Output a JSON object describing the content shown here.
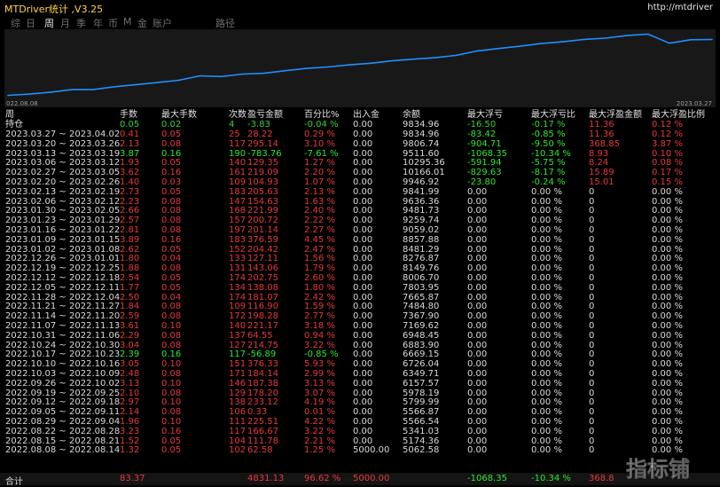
{
  "window": {
    "title": "MTDriver统计  ,V3.25",
    "url": "http://mtdriver"
  },
  "tabs": [
    {
      "label": "综",
      "active": false
    },
    {
      "label": "日",
      "active": false
    },
    {
      "label": "周",
      "active": true
    },
    {
      "label": "月",
      "active": false
    },
    {
      "label": "季",
      "active": false
    },
    {
      "label": "年",
      "active": false
    },
    {
      "label": "币",
      "active": false
    },
    {
      "label": "M",
      "active": false
    },
    {
      "label": "金",
      "active": false
    },
    {
      "label": "账户",
      "active": false
    },
    {
      "label": "路径",
      "active": false
    }
  ],
  "colors": {
    "background": "#000000",
    "chart_line": "#1e90ff",
    "negative": "#e63939",
    "positive": "#2fe62f",
    "accent": "#ffd24a"
  },
  "chart_data": {
    "type": "line",
    "x_start_label": "022.08.08",
    "x_end_label": "2023.03.27",
    "x": [
      "2022.08.08",
      "2022.08.15",
      "2022.08.22",
      "2022.08.29",
      "2022.09.05",
      "2022.09.12",
      "2022.09.19",
      "2022.09.26",
      "2022.10.03",
      "2022.10.10",
      "2022.10.17",
      "2022.10.24",
      "2022.10.31",
      "2022.11.07",
      "2022.11.14",
      "2022.11.21",
      "2022.11.28",
      "2022.12.05",
      "2022.12.12",
      "2022.12.19",
      "2022.12.26",
      "2023.01.02",
      "2023.01.09",
      "2023.01.16",
      "2023.01.23",
      "2023.01.30",
      "2023.02.06",
      "2023.02.13",
      "2023.02.20",
      "2023.02.27",
      "2023.03.06",
      "2023.03.13",
      "2023.03.20",
      "2023.03.27"
    ],
    "values": [
      5062.58,
      5174.36,
      5341.03,
      5566.54,
      5566.87,
      5799.99,
      5978.19,
      6157.57,
      6349.71,
      6726.04,
      6669.15,
      6883.9,
      6948.45,
      7169.62,
      7367.9,
      7484.8,
      7665.87,
      7803.95,
      8006.7,
      8149.76,
      8276.87,
      8481.29,
      8857.88,
      9059.02,
      9259.74,
      9481.73,
      9636.36,
      9841.99,
      9946.92,
      10166.01,
      10295.36,
      9511.6,
      9806.74,
      9834.96
    ],
    "ylim": [
      4800,
      10400
    ],
    "grid": false
  },
  "table": {
    "headers": [
      "周",
      "手数",
      "最大手数",
      "次数",
      "盈亏金额",
      "百分比%",
      "出入金",
      "余额",
      "最大浮亏",
      "最大浮亏比",
      "最大浮盈金额",
      "最大浮盈比例"
    ],
    "hold": {
      "label": "持仓",
      "lots": "0.05",
      "max_lots": "0.02",
      "count": "4",
      "pnl": "-3.83",
      "pct": "-0.04 %",
      "io": "0.00",
      "balance": "9834.96",
      "max_loss": "-16.50",
      "max_loss_pct": "-0.17 %",
      "max_profit": "11.36",
      "max_profit_pct": "0.12 %"
    },
    "rows": [
      {
        "week": "2023.03.27 ~ 2023.04.02",
        "lots": "0.41",
        "max_lots": "0.05",
        "count": "25",
        "pnl": "28.22",
        "pct": "0.29 %",
        "io": "0.00",
        "balance": "9834.96",
        "max_loss": "-83.42",
        "max_loss_pct": "-0.85 %",
        "max_profit": "11.36",
        "max_profit_pct": "0.12 %",
        "sign": "pos"
      },
      {
        "week": "2023.03.20 ~ 2023.03.26",
        "lots": "2.13",
        "max_lots": "0.08",
        "count": "117",
        "pnl": "295.14",
        "pct": "3.10 %",
        "io": "0.00",
        "balance": "9806.74",
        "max_loss": "-904.71",
        "max_loss_pct": "-9.50 %",
        "max_profit": "368.85",
        "max_profit_pct": "3.87 %",
        "sign": "pos"
      },
      {
        "week": "2023.03.13 ~ 2023.03.19",
        "lots": "3.87",
        "max_lots": "0.16",
        "count": "190",
        "pnl": "-783.76",
        "pct": "-7.61 %",
        "io": "0.00",
        "balance": "9511.60",
        "max_loss": "-1068.35",
        "max_loss_pct": "-10.34 %",
        "max_profit": "8.93",
        "max_profit_pct": "0.10 %",
        "sign": "neg"
      },
      {
        "week": "2023.03.06 ~ 2023.03.12",
        "lots": "1.93",
        "max_lots": "0.05",
        "count": "140",
        "pnl": "129.35",
        "pct": "1.27 %",
        "io": "0.00",
        "balance": "10295.36",
        "max_loss": "-591.94",
        "max_loss_pct": "-5.75 %",
        "max_profit": "8.24",
        "max_profit_pct": "0.08 %",
        "sign": "pos"
      },
      {
        "week": "2023.02.27 ~ 2023.03.05",
        "lots": "3.62",
        "max_lots": "0.16",
        "count": "161",
        "pnl": "219.09",
        "pct": "2.20 %",
        "io": "0.00",
        "balance": "10166.01",
        "max_loss": "-829.63",
        "max_loss_pct": "-8.17 %",
        "max_profit": "15.89",
        "max_profit_pct": "0.17 %",
        "sign": "pos"
      },
      {
        "week": "2023.02.20 ~ 2023.02.26",
        "lots": "1.40",
        "max_lots": "0.03",
        "count": "109",
        "pnl": "104.93",
        "pct": "1.07 %",
        "io": "0.00",
        "balance": "9946.92",
        "max_loss": "-23.80",
        "max_loss_pct": "-0.24 %",
        "max_profit": "15.01",
        "max_profit_pct": "0.15 %",
        "sign": "pos"
      },
      {
        "week": "2023.02.13 ~ 2023.02.19",
        "lots": "2.73",
        "max_lots": "0.05",
        "count": "183",
        "pnl": "205.63",
        "pct": "2.13 %",
        "io": "0.00",
        "balance": "9841.99",
        "max_loss": "0.00",
        "max_loss_pct": "0.00 %",
        "max_profit": "0",
        "max_profit_pct": "0.00 %",
        "sign": "pos"
      },
      {
        "week": "2023.02.06 ~ 2023.02.12",
        "lots": "2.23",
        "max_lots": "0.08",
        "count": "147",
        "pnl": "154.63",
        "pct": "1.63 %",
        "io": "0.00",
        "balance": "9636.36",
        "max_loss": "0.00",
        "max_loss_pct": "0.00 %",
        "max_profit": "0",
        "max_profit_pct": "0.00 %",
        "sign": "pos"
      },
      {
        "week": "2023.01.30 ~ 2023.02.05",
        "lots": "2.66",
        "max_lots": "0.08",
        "count": "168",
        "pnl": "221.99",
        "pct": "2.40 %",
        "io": "0.00",
        "balance": "9481.73",
        "max_loss": "0.00",
        "max_loss_pct": "0.00 %",
        "max_profit": "0",
        "max_profit_pct": "0.00 %",
        "sign": "pos"
      },
      {
        "week": "2023.01.23 ~ 2023.01.29",
        "lots": "2.57",
        "max_lots": "0.08",
        "count": "157",
        "pnl": "200.72",
        "pct": "2.22 %",
        "io": "0.00",
        "balance": "9259.74",
        "max_loss": "0.00",
        "max_loss_pct": "0.00 %",
        "max_profit": "0",
        "max_profit_pct": "0.00 %",
        "sign": "pos"
      },
      {
        "week": "2023.01.16 ~ 2023.01.22",
        "lots": "2.81",
        "max_lots": "0.08",
        "count": "197",
        "pnl": "201.14",
        "pct": "2.27 %",
        "io": "0.00",
        "balance": "9059.02",
        "max_loss": "0.00",
        "max_loss_pct": "0.00 %",
        "max_profit": "0",
        "max_profit_pct": "0.00 %",
        "sign": "pos"
      },
      {
        "week": "2023.01.09 ~ 2023.01.15",
        "lots": "3.89",
        "max_lots": "0.16",
        "count": "183",
        "pnl": "376.59",
        "pct": "4.45 %",
        "io": "0.00",
        "balance": "8857.88",
        "max_loss": "0.00",
        "max_loss_pct": "0.00 %",
        "max_profit": "0",
        "max_profit_pct": "0.00 %",
        "sign": "pos"
      },
      {
        "week": "2023.01.02 ~ 2023.01.08",
        "lots": "2.62",
        "max_lots": "0.05",
        "count": "152",
        "pnl": "204.42",
        "pct": "2.47 %",
        "io": "0.00",
        "balance": "8481.29",
        "max_loss": "0.00",
        "max_loss_pct": "0.00 %",
        "max_profit": "0",
        "max_profit_pct": "0.00 %",
        "sign": "pos"
      },
      {
        "week": "2022.12.26 ~ 2023.01.01",
        "lots": "1.80",
        "max_lots": "0.04",
        "count": "133",
        "pnl": "127.11",
        "pct": "1.56 %",
        "io": "0.00",
        "balance": "8276.87",
        "max_loss": "0.00",
        "max_loss_pct": "0.00 %",
        "max_profit": "0",
        "max_profit_pct": "0.00 %",
        "sign": "pos"
      },
      {
        "week": "2022.12.19 ~ 2022.12.25",
        "lots": "1.88",
        "max_lots": "0.08",
        "count": "131",
        "pnl": "143.06",
        "pct": "1.79 %",
        "io": "0.00",
        "balance": "8149.76",
        "max_loss": "0.00",
        "max_loss_pct": "0.00 %",
        "max_profit": "0",
        "max_profit_pct": "0.00 %",
        "sign": "pos"
      },
      {
        "week": "2022.12.12 ~ 2022.12.18",
        "lots": "2.54",
        "max_lots": "0.05",
        "count": "174",
        "pnl": "202.75",
        "pct": "2.60 %",
        "io": "0.00",
        "balance": "8006.70",
        "max_loss": "0.00",
        "max_loss_pct": "0.00 %",
        "max_profit": "0",
        "max_profit_pct": "0.00 %",
        "sign": "pos"
      },
      {
        "week": "2022.12.05 ~ 2022.12.11",
        "lots": "1.77",
        "max_lots": "0.05",
        "count": "134",
        "pnl": "138.08",
        "pct": "1.80 %",
        "io": "0.00",
        "balance": "7803.95",
        "max_loss": "0.00",
        "max_loss_pct": "0.00 %",
        "max_profit": "0",
        "max_profit_pct": "0.00 %",
        "sign": "pos"
      },
      {
        "week": "2022.11.28 ~ 2022.12.04",
        "lots": "2.50",
        "max_lots": "0.04",
        "count": "174",
        "pnl": "181.07",
        "pct": "2.42 %",
        "io": "0.00",
        "balance": "7665.87",
        "max_loss": "0.00",
        "max_loss_pct": "0.00 %",
        "max_profit": "0",
        "max_profit_pct": "0.00 %",
        "sign": "pos"
      },
      {
        "week": "2022.11.21 ~ 2022.11.27",
        "lots": "1.84",
        "max_lots": "0.08",
        "count": "109",
        "pnl": "116.90",
        "pct": "1.59 %",
        "io": "0.00",
        "balance": "7484.80",
        "max_loss": "0.00",
        "max_loss_pct": "0.00 %",
        "max_profit": "0",
        "max_profit_pct": "0.00 %",
        "sign": "pos"
      },
      {
        "week": "2022.11.14 ~ 2022.11.20",
        "lots": "2.59",
        "max_lots": "0.08",
        "count": "172",
        "pnl": "198.28",
        "pct": "2.77 %",
        "io": "0.00",
        "balance": "7367.90",
        "max_loss": "0.00",
        "max_loss_pct": "0.00 %",
        "max_profit": "0",
        "max_profit_pct": "0.00 %",
        "sign": "pos"
      },
      {
        "week": "2022.11.07 ~ 2022.11.13",
        "lots": "3.61",
        "max_lots": "0.10",
        "count": "140",
        "pnl": "221.17",
        "pct": "3.18 %",
        "io": "0.00",
        "balance": "7169.62",
        "max_loss": "0.00",
        "max_loss_pct": "0.00 %",
        "max_profit": "0",
        "max_profit_pct": "0.00 %",
        "sign": "pos"
      },
      {
        "week": "2022.10.31 ~ 2022.11.06",
        "lots": "2.29",
        "max_lots": "0.08",
        "count": "137",
        "pnl": "64.55",
        "pct": "0.94 %",
        "io": "0.00",
        "balance": "6948.45",
        "max_loss": "0.00",
        "max_loss_pct": "0.00 %",
        "max_profit": "0",
        "max_profit_pct": "0.00 %",
        "sign": "pos"
      },
      {
        "week": "2022.10.24 ~ 2022.10.30",
        "lots": "3.04",
        "max_lots": "0.08",
        "count": "127",
        "pnl": "214.75",
        "pct": "3.22 %",
        "io": "0.00",
        "balance": "6883.90",
        "max_loss": "0.00",
        "max_loss_pct": "0.00 %",
        "max_profit": "0",
        "max_profit_pct": "0.00 %",
        "sign": "pos"
      },
      {
        "week": "2022.10.17 ~ 2022.10.23",
        "lots": "2.39",
        "max_lots": "0.16",
        "count": "117",
        "pnl": "-56.89",
        "pct": "-0.85 %",
        "io": "0.00",
        "balance": "6669.15",
        "max_loss": "0.00",
        "max_loss_pct": "0.00 %",
        "max_profit": "0",
        "max_profit_pct": "0.00 %",
        "sign": "neg"
      },
      {
        "week": "2022.10.10 ~ 2022.10.16",
        "lots": "3.05",
        "max_lots": "0.10",
        "count": "151",
        "pnl": "376.33",
        "pct": "5.93 %",
        "io": "0.00",
        "balance": "6726.04",
        "max_loss": "0.00",
        "max_loss_pct": "0.00 %",
        "max_profit": "0",
        "max_profit_pct": "0.00 %",
        "sign": "pos"
      },
      {
        "week": "2022.10.03 ~ 2022.10.09",
        "lots": "2.48",
        "max_lots": "0.08",
        "count": "171",
        "pnl": "184.14",
        "pct": "2.99 %",
        "io": "0.00",
        "balance": "6349.71",
        "max_loss": "0.00",
        "max_loss_pct": "0.00 %",
        "max_profit": "0",
        "max_profit_pct": "0.00 %",
        "sign": "pos"
      },
      {
        "week": "2022.09.26 ~ 2022.10.02",
        "lots": "3.13",
        "max_lots": "0.10",
        "count": "146",
        "pnl": "187.38",
        "pct": "3.13 %",
        "io": "0.00",
        "balance": "6157.57",
        "max_loss": "0.00",
        "max_loss_pct": "0.00 %",
        "max_profit": "0",
        "max_profit_pct": "0.00 %",
        "sign": "pos"
      },
      {
        "week": "2022.09.19 ~ 2022.09.25",
        "lots": "2.10",
        "max_lots": "0.08",
        "count": "129",
        "pnl": "178.20",
        "pct": "3.07 %",
        "io": "0.00",
        "balance": "5978.19",
        "max_loss": "0.00",
        "max_loss_pct": "0.00 %",
        "max_profit": "0",
        "max_profit_pct": "0.00 %",
        "sign": "pos"
      },
      {
        "week": "2022.09.12 ~ 2022.09.18",
        "lots": "2.97",
        "max_lots": "0.10",
        "count": "138",
        "pnl": "233.12",
        "pct": "4.19 %",
        "io": "0.00",
        "balance": "5799.99",
        "max_loss": "0.00",
        "max_loss_pct": "0.00 %",
        "max_profit": "0",
        "max_profit_pct": "0.00 %",
        "sign": "pos"
      },
      {
        "week": "2022.09.05 ~ 2022.09.11",
        "lots": "2.14",
        "max_lots": "0.08",
        "count": "106",
        "pnl": "0.33",
        "pct": "0.01 %",
        "io": "0.00",
        "balance": "5566.87",
        "max_loss": "0.00",
        "max_loss_pct": "0.00 %",
        "max_profit": "0",
        "max_profit_pct": "0.00 %",
        "sign": "pos"
      },
      {
        "week": "2022.08.29 ~ 2022.09.04",
        "lots": "1.96",
        "max_lots": "0.10",
        "count": "111",
        "pnl": "225.51",
        "pct": "4.22 %",
        "io": "0.00",
        "balance": "5566.54",
        "max_loss": "0.00",
        "max_loss_pct": "0.00 %",
        "max_profit": "0",
        "max_profit_pct": "0.00 %",
        "sign": "pos"
      },
      {
        "week": "2022.08.22 ~ 2022.08.28",
        "lots": "3.23",
        "max_lots": "0.16",
        "count": "117",
        "pnl": "166.67",
        "pct": "3.22 %",
        "io": "0.00",
        "balance": "5341.03",
        "max_loss": "0.00",
        "max_loss_pct": "0.00 %",
        "max_profit": "0",
        "max_profit_pct": "0.00 %",
        "sign": "pos"
      },
      {
        "week": "2022.08.15 ~ 2022.08.21",
        "lots": "1.52",
        "max_lots": "0.05",
        "count": "104",
        "pnl": "111.78",
        "pct": "2.21 %",
        "io": "0.00",
        "balance": "5174.36",
        "max_loss": "0.00",
        "max_loss_pct": "0.00 %",
        "max_profit": "0",
        "max_profit_pct": "0.00 %",
        "sign": "pos"
      },
      {
        "week": "2022.08.08 ~ 2022.08.14",
        "lots": "1.32",
        "max_lots": "0.05",
        "count": "102",
        "pnl": "62.58",
        "pct": "1.25 %",
        "io": "5000.00",
        "balance": "5062.58",
        "max_loss": "0.00",
        "max_loss_pct": "0.00 %",
        "max_profit": "0",
        "max_profit_pct": "0.00 %",
        "sign": "pos"
      }
    ],
    "total": {
      "label": "合计",
      "lots": "83.37",
      "pnl": "4831.13",
      "pct": "96.62 %",
      "io": "5000.00",
      "max_loss": "-1068.35",
      "max_loss_pct": "-10.34 %",
      "max_profit": "368.8"
    }
  },
  "watermark": {
    "text": "指标铺"
  }
}
